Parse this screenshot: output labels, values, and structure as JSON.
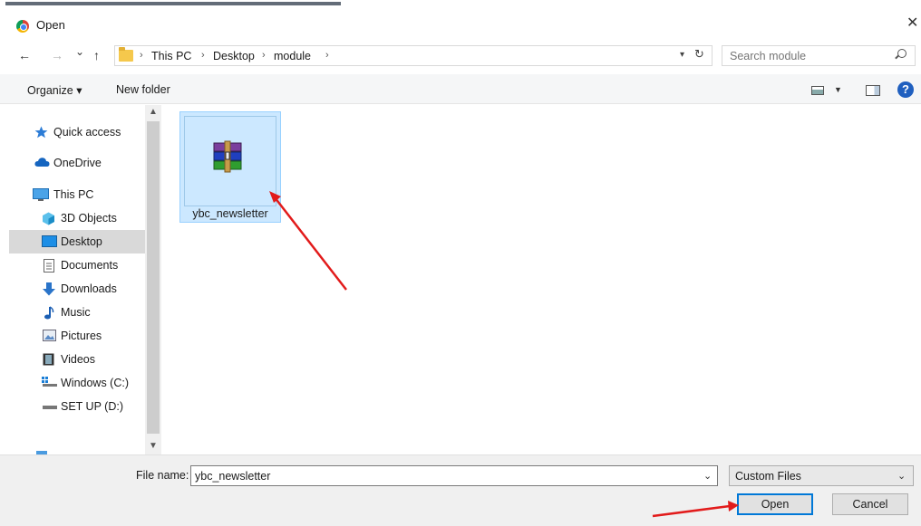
{
  "window": {
    "title": "Open",
    "close_glyph": "✕"
  },
  "nav": {
    "back": "←",
    "forward": "→",
    "recent": "⌄",
    "up": "↑",
    "breadcrumbs": [
      "This PC",
      "Desktop",
      "module"
    ],
    "separator": "›",
    "search_placeholder": "Search module"
  },
  "toolbar": {
    "organize_label": "Organize ▾",
    "new_folder_label": "New folder",
    "help_label": "?"
  },
  "sidebar": {
    "items": [
      {
        "label": "Quick access",
        "icon": "star-icon"
      },
      {
        "label": "OneDrive",
        "icon": "cloud-icon"
      },
      {
        "label": "This PC",
        "icon": "monitor-icon"
      },
      {
        "label": "3D Objects",
        "icon": "cube-icon"
      },
      {
        "label": "Desktop",
        "icon": "desktop-icon",
        "selected": true
      },
      {
        "label": "Documents",
        "icon": "document-icon"
      },
      {
        "label": "Downloads",
        "icon": "download-icon"
      },
      {
        "label": "Music",
        "icon": "music-icon"
      },
      {
        "label": "Pictures",
        "icon": "pictures-icon"
      },
      {
        "label": "Videos",
        "icon": "film-icon"
      },
      {
        "label": "Windows (C:)",
        "icon": "drive-icon"
      },
      {
        "label": "SET UP (D:)",
        "icon": "drive-icon"
      }
    ]
  },
  "files": [
    {
      "name": "ybc_newsletter",
      "icon": "winrar-archive-icon",
      "selected": true
    }
  ],
  "footer": {
    "file_name_label": "File name:",
    "file_name_value": "ybc_newsletter",
    "filter_value": "Custom Files",
    "open_label": "Open",
    "cancel_label": "Cancel"
  },
  "colors": {
    "selection": "#cce8ff",
    "annotation_arrow": "#e21b1b",
    "accent": "#0078d7"
  }
}
